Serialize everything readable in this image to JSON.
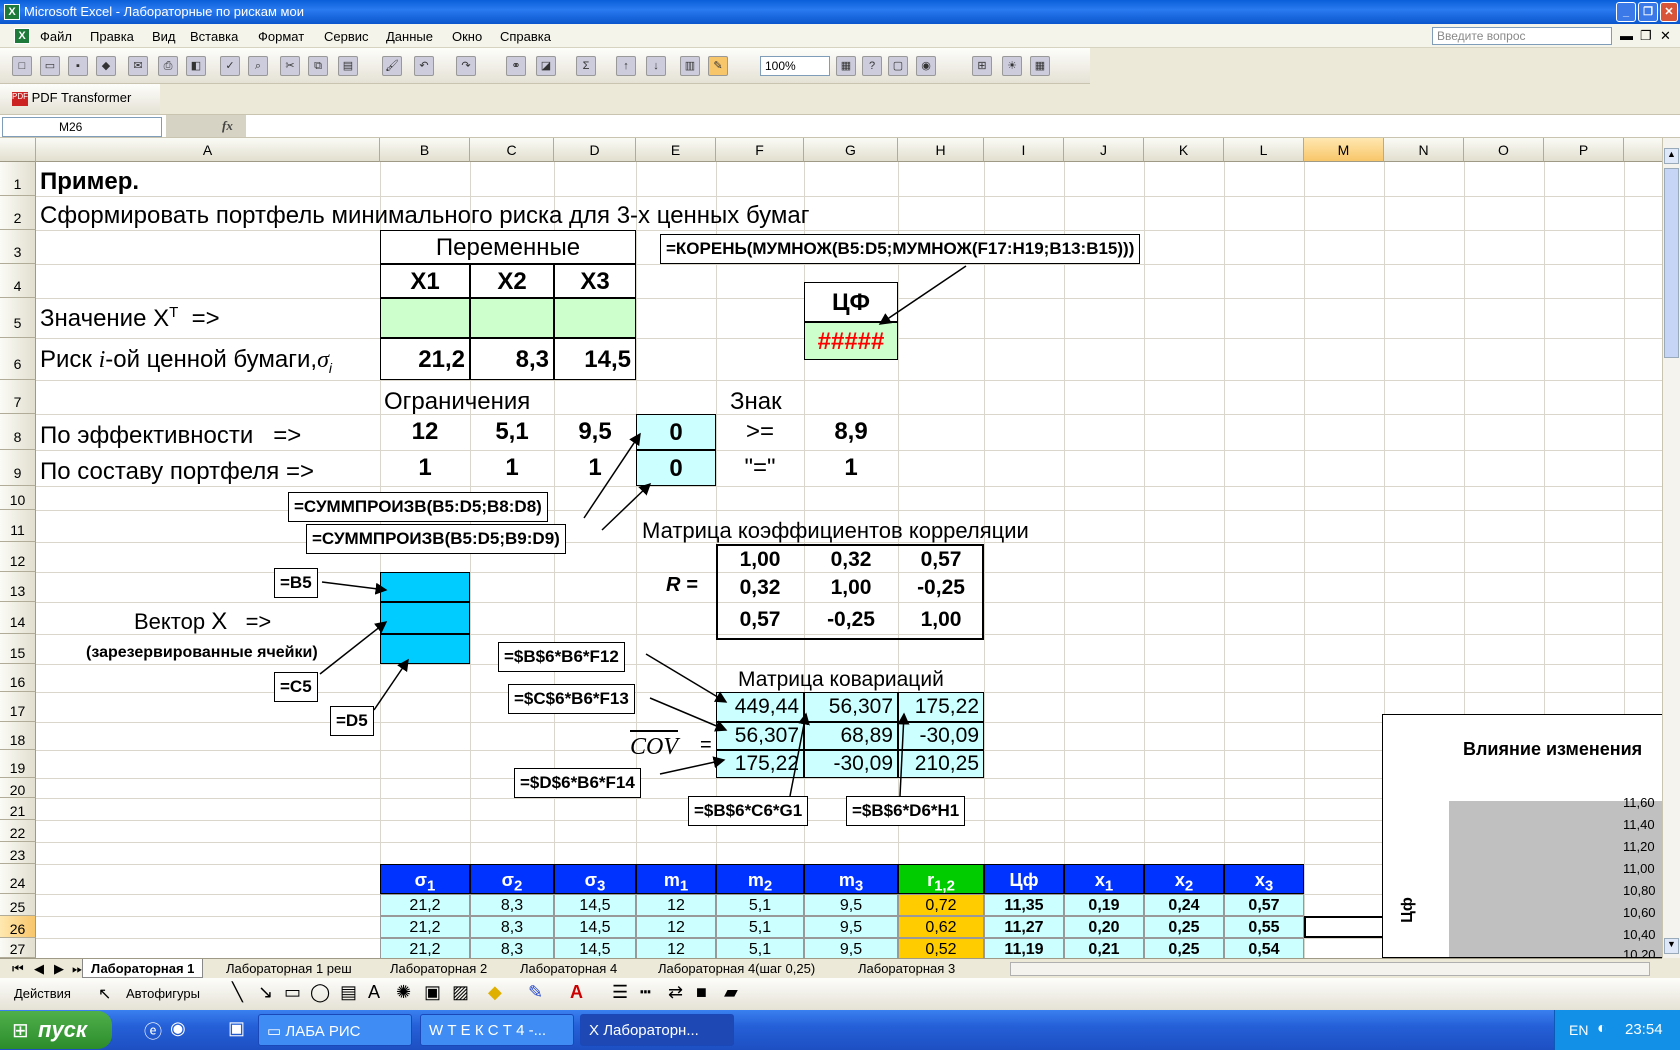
{
  "window": {
    "title": "Microsoft Excel - Лабораторные по рискам мои"
  },
  "menu": {
    "items": [
      "Файл",
      "Правка",
      "Вид",
      "Вставка",
      "Формат",
      "Сервис",
      "Данные",
      "Окно",
      "Справка"
    ],
    "ask_placeholder": "Введите вопрос"
  },
  "toolbar": {
    "zoom": "100%",
    "pdf_label": "PDF Transformer"
  },
  "formula_bar": {
    "name_box": "M26",
    "fx": "fx"
  },
  "columns": [
    "A",
    "B",
    "C",
    "D",
    "E",
    "F",
    "G",
    "H",
    "I",
    "J",
    "K",
    "L",
    "M",
    "N",
    "O",
    "P"
  ],
  "rows": [
    "1",
    "2",
    "3",
    "4",
    "5",
    "6",
    "7",
    "8",
    "9",
    "10",
    "11",
    "12",
    "13",
    "14",
    "15",
    "16",
    "17",
    "18",
    "19",
    "20",
    "21",
    "22",
    "23",
    "24",
    "25",
    "26",
    "27"
  ],
  "sheet": {
    "title": "Пример.",
    "task": "Сформировать портфель минимального риска для 3-х ценных бумаг",
    "variables_header": "Переменные",
    "x_headers": [
      "X1",
      "X2",
      "X3"
    ],
    "value_label": "Значение X",
    "value_sup": "T",
    "value_arrow": "=>",
    "risk_label": "Риск",
    "risk_i": "i",
    "risk_label2": "-ой ценной бумаги,",
    "risk_sigma": "σ",
    "risk_sub": "i",
    "risk_values": [
      "21,2",
      "8,3",
      "14,5"
    ],
    "cf_label": "ЦФ",
    "cf_value": "#####",
    "formula_cf": "=КОРЕНЬ(МУМНОЖ(B5:D5;МУМНОЖ(F17:H19;B13:B15)))",
    "constraints_label": "Ограничения",
    "sign_label": "Знак",
    "efficiency_label": "По эффективности   =>",
    "efficiency_values": [
      "12",
      "5,1",
      "9,5"
    ],
    "efficiency_result": "0",
    "efficiency_sign": ">=",
    "efficiency_rhs": "8,9",
    "composition_label": "По составу портфеля =>",
    "composition_values": [
      "1",
      "1",
      "1"
    ],
    "composition_result": "0",
    "composition_sign": "\"=\"",
    "composition_rhs": "1",
    "formula_e8": "=СУММПРОИЗВ(B5:D5;B8:D8)",
    "formula_e9": "=СУММПРОИЗВ(B5:D5;B9:D9)",
    "corr_title": "Матрица коэффициентов корреляции",
    "corr_label": "R =",
    "corr_matrix": [
      [
        "1,00",
        "0,32",
        "0,57"
      ],
      [
        "0,32",
        "1,00",
        "-0,25"
      ],
      [
        "0,57",
        "-0,25",
        "1,00"
      ]
    ],
    "vector_label": "Вектор",
    "vector_x": "X",
    "vector_arrow": "=>",
    "reserved_label": "(зарезервированные ячейки)",
    "formula_b13": "=B5",
    "formula_b14": "=C5",
    "formula_b15": "=D5",
    "cov_title": "Матрица ковариаций",
    "cov_label": "COV",
    "cov_eq": "=",
    "cov_matrix": [
      [
        "449,44",
        "56,307",
        "175,22"
      ],
      [
        "56,307",
        "68,89",
        "-30,09"
      ],
      [
        "175,22",
        "-30,09",
        "210,25"
      ]
    ],
    "formula_f17": "=$B$6*B6*F12",
    "formula_f18": "=$C$6*B6*F13",
    "formula_f19": "=$D$6*B6*F14",
    "formula_g17": "=$B$6*C6*G1",
    "formula_h17": "=$B$6*D6*H1",
    "table_headers": [
      {
        "base": "σ",
        "sub": "1"
      },
      {
        "base": "σ",
        "sub": "2"
      },
      {
        "base": "σ",
        "sub": "3"
      },
      {
        "base": "m",
        "sub": "1"
      },
      {
        "base": "m",
        "sub": "2"
      },
      {
        "base": "m",
        "sub": "3"
      },
      {
        "base": "r",
        "sub": "1,2"
      },
      {
        "base": "Цф",
        "sub": ""
      },
      {
        "base": "x",
        "sub": "1"
      },
      {
        "base": "x",
        "sub": "2"
      },
      {
        "base": "x",
        "sub": "3"
      }
    ],
    "table_rows": [
      [
        "21,2",
        "8,3",
        "14,5",
        "12",
        "5,1",
        "9,5",
        "0,72",
        "11,35",
        "0,19",
        "0,24",
        "0,57"
      ],
      [
        "21,2",
        "8,3",
        "14,5",
        "12",
        "5,1",
        "9,5",
        "0,62",
        "11,27",
        "0,20",
        "0,25",
        "0,55"
      ],
      [
        "21,2",
        "8,3",
        "14,5",
        "12",
        "5,1",
        "9,5",
        "0,52",
        "11,19",
        "0,21",
        "0,25",
        "0,54"
      ]
    ]
  },
  "chart": {
    "title": "Влияние изменения",
    "y_label": "Цф",
    "y_ticks": [
      "11,60",
      "11,40",
      "11,20",
      "11,00",
      "10,80",
      "10,60",
      "10,40",
      "10,20"
    ]
  },
  "tabs": [
    "Лабораторная 1",
    "Лабораторная 1 реш",
    "Лабораторная 2",
    "Лабораторная 4",
    "Лабораторная 4(шаг 0,25)",
    "Лабораторная 3"
  ],
  "drawing": {
    "actions": "Действия",
    "autoshapes": "Автофигуры"
  },
  "taskbar": {
    "start": "пуск",
    "tasks": [
      "ЛАБА РИС",
      "Т Е К С Т 4 -...",
      "Лабораторн..."
    ],
    "lang": "EN",
    "time": "23:54"
  },
  "colors": {
    "green_cell": "#ccffcc",
    "cyan_cell": "#ccffff",
    "blue_cell": "#00ccff",
    "header_blue": "#0033ff",
    "header_green": "#00cc00",
    "orange_cell": "#ffcc00",
    "error_red": "#ff0000"
  }
}
